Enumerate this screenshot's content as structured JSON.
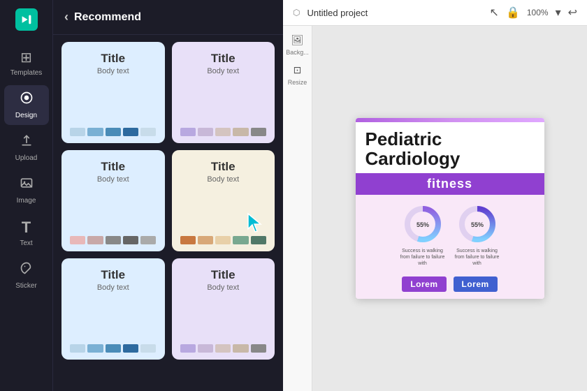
{
  "sidebar": {
    "logo_label": "CapCut",
    "items": [
      {
        "id": "templates",
        "label": "Templates",
        "icon": "⊞",
        "active": false
      },
      {
        "id": "design",
        "label": "Design",
        "icon": "🎨",
        "active": true
      },
      {
        "id": "upload",
        "label": "Upload",
        "icon": "⬆",
        "active": false
      },
      {
        "id": "image",
        "label": "Image",
        "icon": "🖼",
        "active": false
      },
      {
        "id": "text",
        "label": "Text",
        "icon": "T",
        "active": false
      },
      {
        "id": "sticker",
        "label": "Sticker",
        "icon": "✿",
        "active": false
      }
    ]
  },
  "panel": {
    "back_label": "‹",
    "title": "Recommend",
    "cards": [
      {
        "id": "card1",
        "title": "Title",
        "body": "Body text",
        "bg": "light-blue",
        "swatches": [
          "s1-1",
          "s1-2",
          "s1-3",
          "s1-4",
          "s1-5"
        ]
      },
      {
        "id": "card2",
        "title": "Title",
        "body": "Body text",
        "bg": "light-purple",
        "swatches": [
          "s2-1",
          "s2-2",
          "s2-3",
          "s2-4",
          "s2-5"
        ]
      },
      {
        "id": "card3",
        "title": "Title",
        "body": "Body text",
        "bg": "light-blue",
        "swatches": [
          "s3-1",
          "s3-2",
          "s3-3",
          "s3-4",
          "s3-5"
        ]
      },
      {
        "id": "card4",
        "title": "Title",
        "body": "Body text",
        "bg": "beige",
        "swatches": [
          "s4-1",
          "s4-2",
          "s4-3",
          "s4-4",
          "s4-5"
        ],
        "has_cursor": true
      },
      {
        "id": "card5",
        "title": "Title",
        "body": "Body text",
        "bg": "light-blue",
        "swatches": [
          "s5-1",
          "s5-2",
          "s5-3",
          "s5-4",
          "s5-5"
        ]
      },
      {
        "id": "card6",
        "title": "Title",
        "body": "Body text",
        "bg": "light-purple",
        "swatches": [
          "s6-1",
          "s6-2",
          "s6-3",
          "s6-4",
          "s6-5"
        ]
      }
    ]
  },
  "editor": {
    "project_name": "Untitled project",
    "zoom_level": "100%",
    "slide": {
      "top_gradient": "purple",
      "main_title_line1": "Pediatric",
      "main_title_line2": "Cardiology",
      "fitness_label": "fitness",
      "chart1_percent": "55%",
      "chart2_percent": "55%",
      "chart1_caption": "Success is walking from failure to failure with",
      "chart2_caption": "Success is walking from failure to failure with",
      "lorem1": "Lorem",
      "lorem2": "Lorem"
    },
    "right_panel": {
      "items": [
        {
          "label": "Backg...",
          "icon": "🖼"
        },
        {
          "label": "Resize",
          "icon": "⊡"
        }
      ]
    }
  }
}
